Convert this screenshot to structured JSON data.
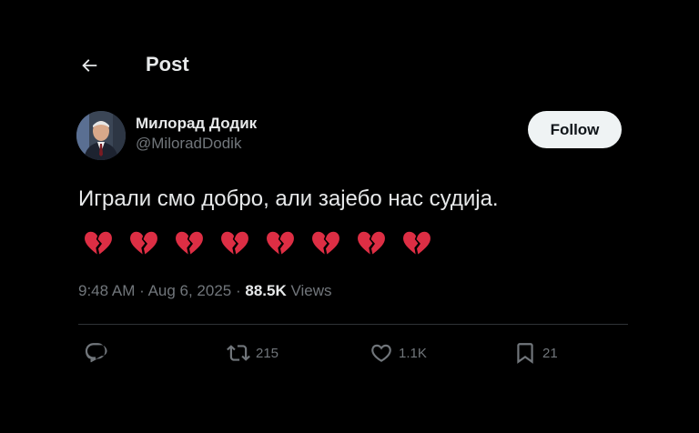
{
  "header": {
    "title": "Post",
    "back_icon": "arrow-left-icon"
  },
  "author": {
    "display_name": "Милорад Додик",
    "handle": "@MiloradDodik"
  },
  "follow_label": "Follow",
  "tweet": {
    "text": "Играли смо добро, али зајебо нас судија.",
    "emojis": [
      "broken-heart",
      "broken-heart",
      "broken-heart",
      "broken-heart",
      "broken-heart",
      "broken-heart",
      "broken-heart",
      "broken-heart"
    ]
  },
  "meta": {
    "time": "9:48 AM",
    "date": "Aug 6, 2025",
    "views_count": "88.5K",
    "views_label": "Views"
  },
  "actions": {
    "replies": "",
    "reposts": "215",
    "likes": "1.1K",
    "bookmarks": "21"
  },
  "colors": {
    "background": "#000000",
    "text": "#e7e9ea",
    "secondary": "#71767b",
    "follow_bg": "#eff3f4",
    "broken_heart": "#dd2e44"
  }
}
